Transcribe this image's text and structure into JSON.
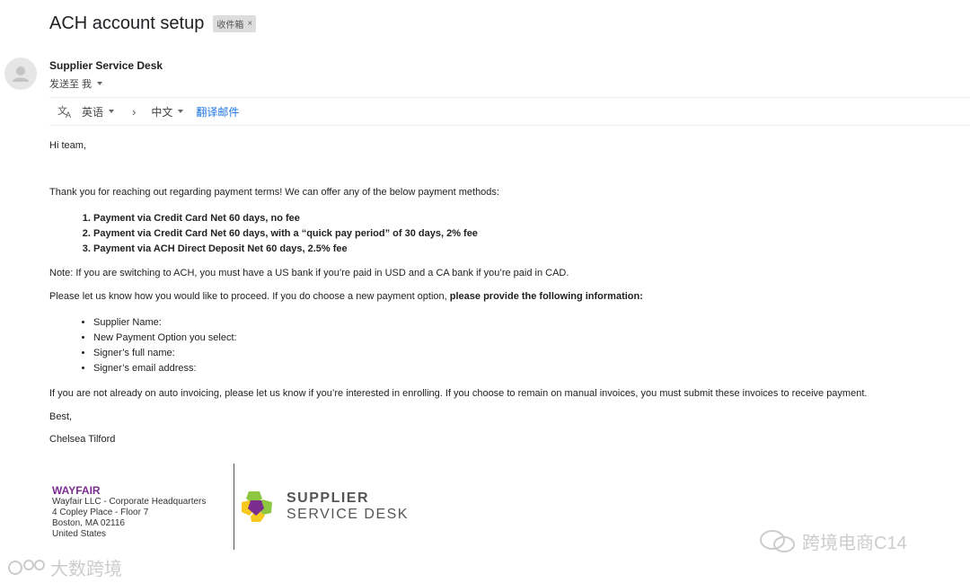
{
  "email": {
    "subject": "ACH account setup",
    "label_chip": "收件箱",
    "sender_name": "Supplier Service Desk",
    "to_line": "发送至 我"
  },
  "translate_bar": {
    "from_lang": "英语",
    "to_lang": "中文",
    "translate_link": "翻译邮件"
  },
  "body": {
    "greeting": "Hi team,",
    "intro": "Thank you for reaching out regarding payment terms! We can offer any of the below payment methods:",
    "methods": [
      "Payment via Credit Card Net 60 days, no fee",
      "Payment via Credit Card Net 60 days, with a “quick pay period” of 30 days, 2% fee",
      "Payment via ACH Direct Deposit Net 60 days, 2.5% fee"
    ],
    "note": "Note: If you are switching to ACH, you must have a US bank if you’re paid in USD and a CA bank if you’re paid in CAD.",
    "proceed_plain": "Please let us know how you would like to proceed. If you do choose a new payment option, ",
    "proceed_bold": "please provide the following information:",
    "fields": [
      "Supplier Name:",
      "New Payment Option you select:",
      "Signer’s full name:",
      "Signer’s email address:"
    ],
    "auto_invoicing": "If you are not already on auto invoicing, please let us know if you’re interested in enrolling. If you choose to remain on manual invoices, you must submit these invoices to receive payment.",
    "closing": "Best,",
    "signer": "Chelsea Tilford"
  },
  "signature": {
    "brand": "WAYFAIR",
    "lines": [
      "Wayfair LLC - Corporate Headquarters",
      "4 Copley Place - Floor 7",
      "Boston, MA 02116",
      "United States"
    ],
    "logo_line1": "SUPPLIER",
    "logo_line2": "SERVICE DESK"
  },
  "watermarks": {
    "right": "跨境电商C14",
    "left": "大数跨境"
  },
  "colors": {
    "brand_purple": "#7b2d8e",
    "link_blue": "#1a73e8",
    "logo_green": "#8dc63f",
    "logo_yellow": "#f7c81e",
    "logo_purple": "#7b2d8e"
  }
}
